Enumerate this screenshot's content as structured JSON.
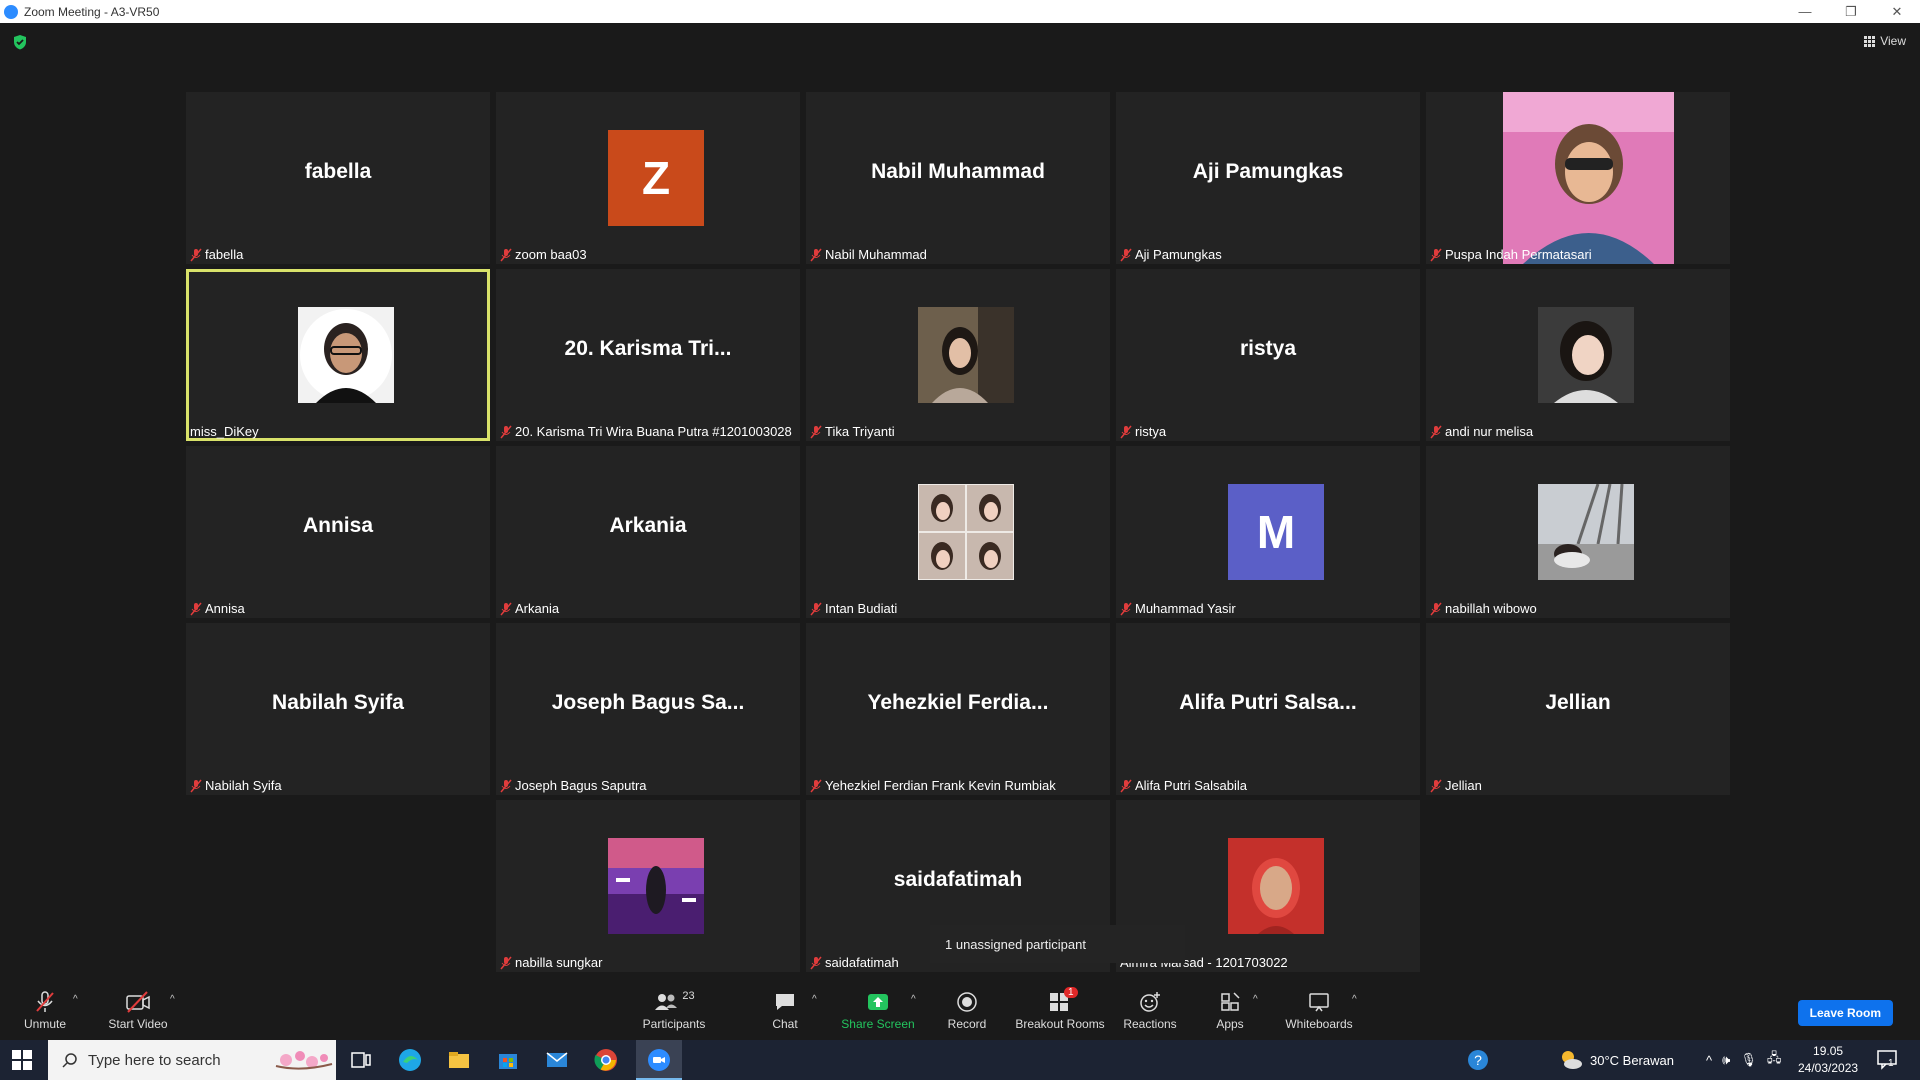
{
  "window": {
    "title": "Zoom Meeting - A3-VR50",
    "minimize": "—",
    "restore": "❐",
    "close": "✕"
  },
  "view_label": "View",
  "tiles": [
    {
      "name": "fabella",
      "display": "fabella"
    },
    {
      "name": "zoom baa03",
      "letter": "Z",
      "color": "#c94a1b"
    },
    {
      "name": "Nabil Muhammad",
      "display": "Nabil Muhammad"
    },
    {
      "name": "Aji Pamungkas",
      "display": "Aji Pamungkas"
    },
    {
      "name": "Puspa Indah Permatasari"
    },
    {
      "name": "miss_DiKey"
    },
    {
      "name": "20. Karisma Tri Wira Buana Putra #1201003028",
      "display": "20. Karisma Tri..."
    },
    {
      "name": "Tika Triyanti"
    },
    {
      "name": "ristya",
      "display": "ristya"
    },
    {
      "name": "andi nur melisa"
    },
    {
      "name": "Annisa",
      "display": "Annisa"
    },
    {
      "name": "Arkania",
      "display": "Arkania"
    },
    {
      "name": "Intan Budiati"
    },
    {
      "name": "Muhammad Yasir",
      "letter": "M",
      "color": "#5b5fc7"
    },
    {
      "name": "nabillah wibowo"
    },
    {
      "name": "Nabilah Syifa",
      "display": "Nabilah Syifa"
    },
    {
      "name": "Joseph Bagus Saputra",
      "display": "Joseph Bagus Sa..."
    },
    {
      "name": "Yehezkiel Ferdian Frank Kevin Rumbiak",
      "display": "Yehezkiel  Ferdia..."
    },
    {
      "name": "Alifa Putri Salsabila",
      "display": "Alifa Putri Salsa..."
    },
    {
      "name": "Jellian",
      "display": "Jellian"
    },
    {
      "name": "nabilla sungkar"
    },
    {
      "name": "saidafatimah",
      "display": "saidafatimah"
    },
    {
      "name": "Almira Marsad - 1201703022"
    }
  ],
  "popup": "1 unassigned participant",
  "toolbar": {
    "unmute": "Unmute",
    "start_video": "Start Video",
    "participants": "Participants",
    "participants_count": "23",
    "chat": "Chat",
    "share_screen": "Share Screen",
    "record": "Record",
    "breakout_rooms": "Breakout Rooms",
    "breakout_badge": "1",
    "reactions": "Reactions",
    "apps": "Apps",
    "whiteboards": "Whiteboards",
    "leave": "Leave Room"
  },
  "taskbar": {
    "search_placeholder": "Type here to search",
    "weather": "30°C  Berawan",
    "time": "19.05",
    "date": "24/03/2023",
    "notification_count": "1"
  },
  "colors": {
    "active_border": "#d9e26a",
    "tile_bg": "#232323",
    "leave_blue": "#0e72ed",
    "share_green": "#23c45e",
    "badge_red": "#e02828"
  }
}
